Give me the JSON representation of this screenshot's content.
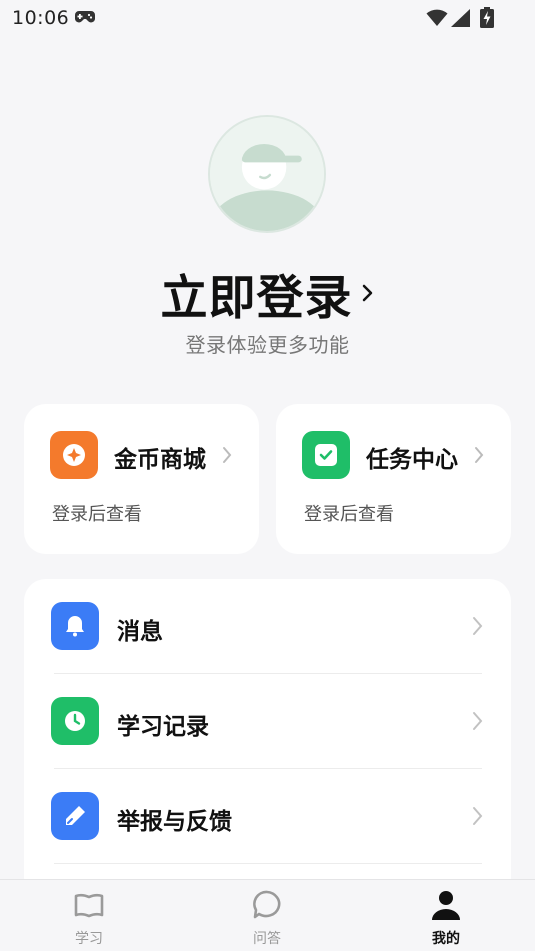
{
  "status_bar": {
    "time": "10:06"
  },
  "profile": {
    "login_title": "立即登录",
    "login_subtitle": "登录体验更多功能"
  },
  "cards": [
    {
      "title": "金币商城",
      "subtitle": "登录后查看",
      "icon": "coin-mall-icon",
      "color": "#f47a2c"
    },
    {
      "title": "任务中心",
      "subtitle": "登录后查看",
      "icon": "task-check-icon",
      "color": "#1fbe68"
    }
  ],
  "menu": [
    {
      "label": "消息",
      "icon": "bell-icon",
      "color": "#3b7cf6"
    },
    {
      "label": "学习记录",
      "icon": "clock-icon",
      "color": "#1fbe68"
    },
    {
      "label": "举报与反馈",
      "icon": "pen-icon",
      "color": "#3b7cf6"
    }
  ],
  "tabs": [
    {
      "label": "学习",
      "icon": "book-icon",
      "active": false
    },
    {
      "label": "问答",
      "icon": "chat-bubble-icon",
      "active": false
    },
    {
      "label": "我的",
      "icon": "person-icon",
      "active": true
    }
  ]
}
